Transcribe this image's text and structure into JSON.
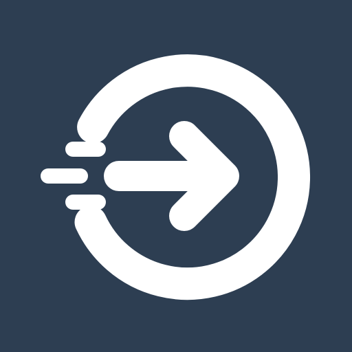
{
  "app_icon": {
    "icon_name": "login-arrow-circle-icon",
    "background_color": "#2d3e52",
    "foreground_color": "#ffffff"
  }
}
